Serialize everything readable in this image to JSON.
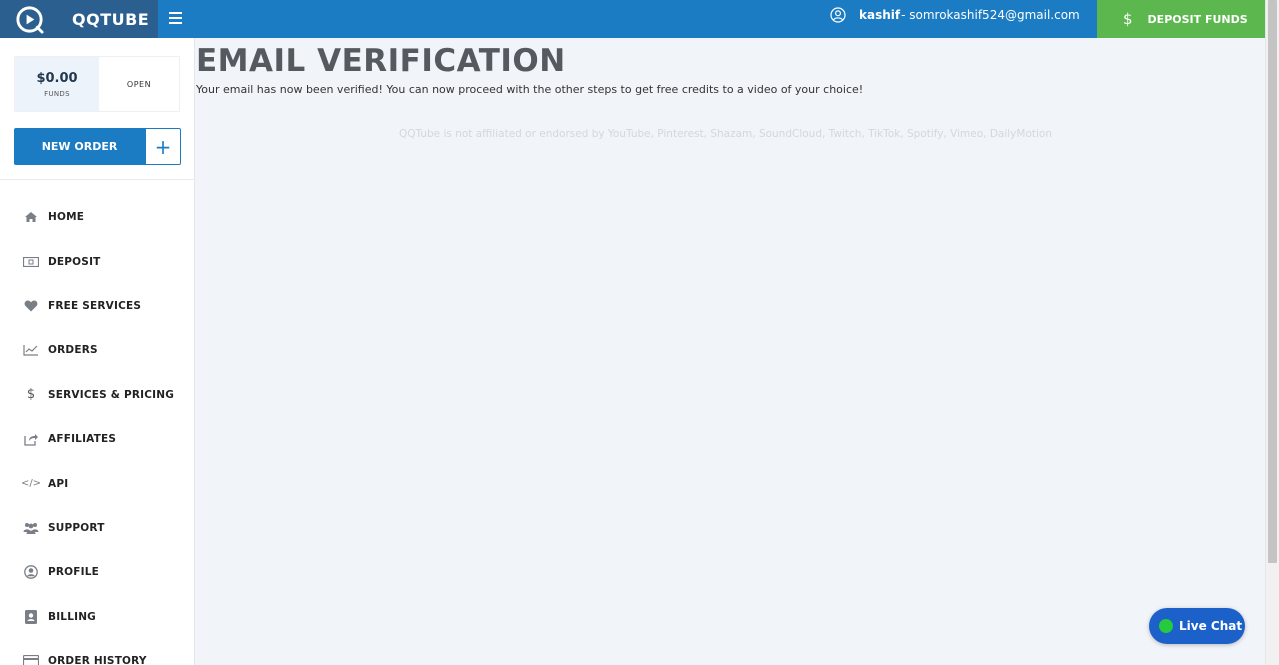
{
  "brand": {
    "name": "QQTUBE",
    "logo_icon": "play-circle-icon",
    "accent": "#1b7cc4",
    "logo_bg": "#2a5f8f"
  },
  "header": {
    "menu_icon": "hamburger-icon",
    "user_icon": "user-circle-icon",
    "username": "kashif",
    "email": "- somrokashif524@gmail.com",
    "deposit_label": "DEPOSIT FUNDS",
    "deposit_symbol": "$",
    "deposit_color": "#5cb74f"
  },
  "sidebar": {
    "funds_amount": "$0.00",
    "funds_label": "FUNDS",
    "open_label": "OPEN",
    "new_order_label": "NEW ORDER",
    "new_order_plus": "+",
    "items": [
      {
        "label": "HOME",
        "icon": "home-icon"
      },
      {
        "label": "DEPOSIT",
        "icon": "money-bill-icon"
      },
      {
        "label": "FREE SERVICES",
        "icon": "heart-icon"
      },
      {
        "label": "ORDERS",
        "icon": "chart-line-icon"
      },
      {
        "label": "SERVICES & PRICING",
        "icon": "dollar-icon"
      },
      {
        "label": "AFFILIATES",
        "icon": "share-icon"
      },
      {
        "label": "API",
        "icon": "code-icon"
      },
      {
        "label": "SUPPORT",
        "icon": "users-icon"
      },
      {
        "label": "PROFILE",
        "icon": "user-circle-icon"
      },
      {
        "label": "BILLING",
        "icon": "id-card-icon"
      },
      {
        "label": "ORDER HISTORY",
        "icon": "credit-card-icon"
      }
    ]
  },
  "main": {
    "title": "EMAIL VERIFICATION",
    "message": "Your email has now been verified! You can now proceed with the other steps to get free credits to a video of your choice!",
    "disclaimer": "QQTube is not affiliated or endorsed by YouTube, Pinterest, Shazam, SoundCloud, Twitch, TikTok, Spotify, Vimeo, DailyMotion"
  },
  "live_chat": {
    "label": "Live Chat",
    "status_color": "#27c93f"
  }
}
